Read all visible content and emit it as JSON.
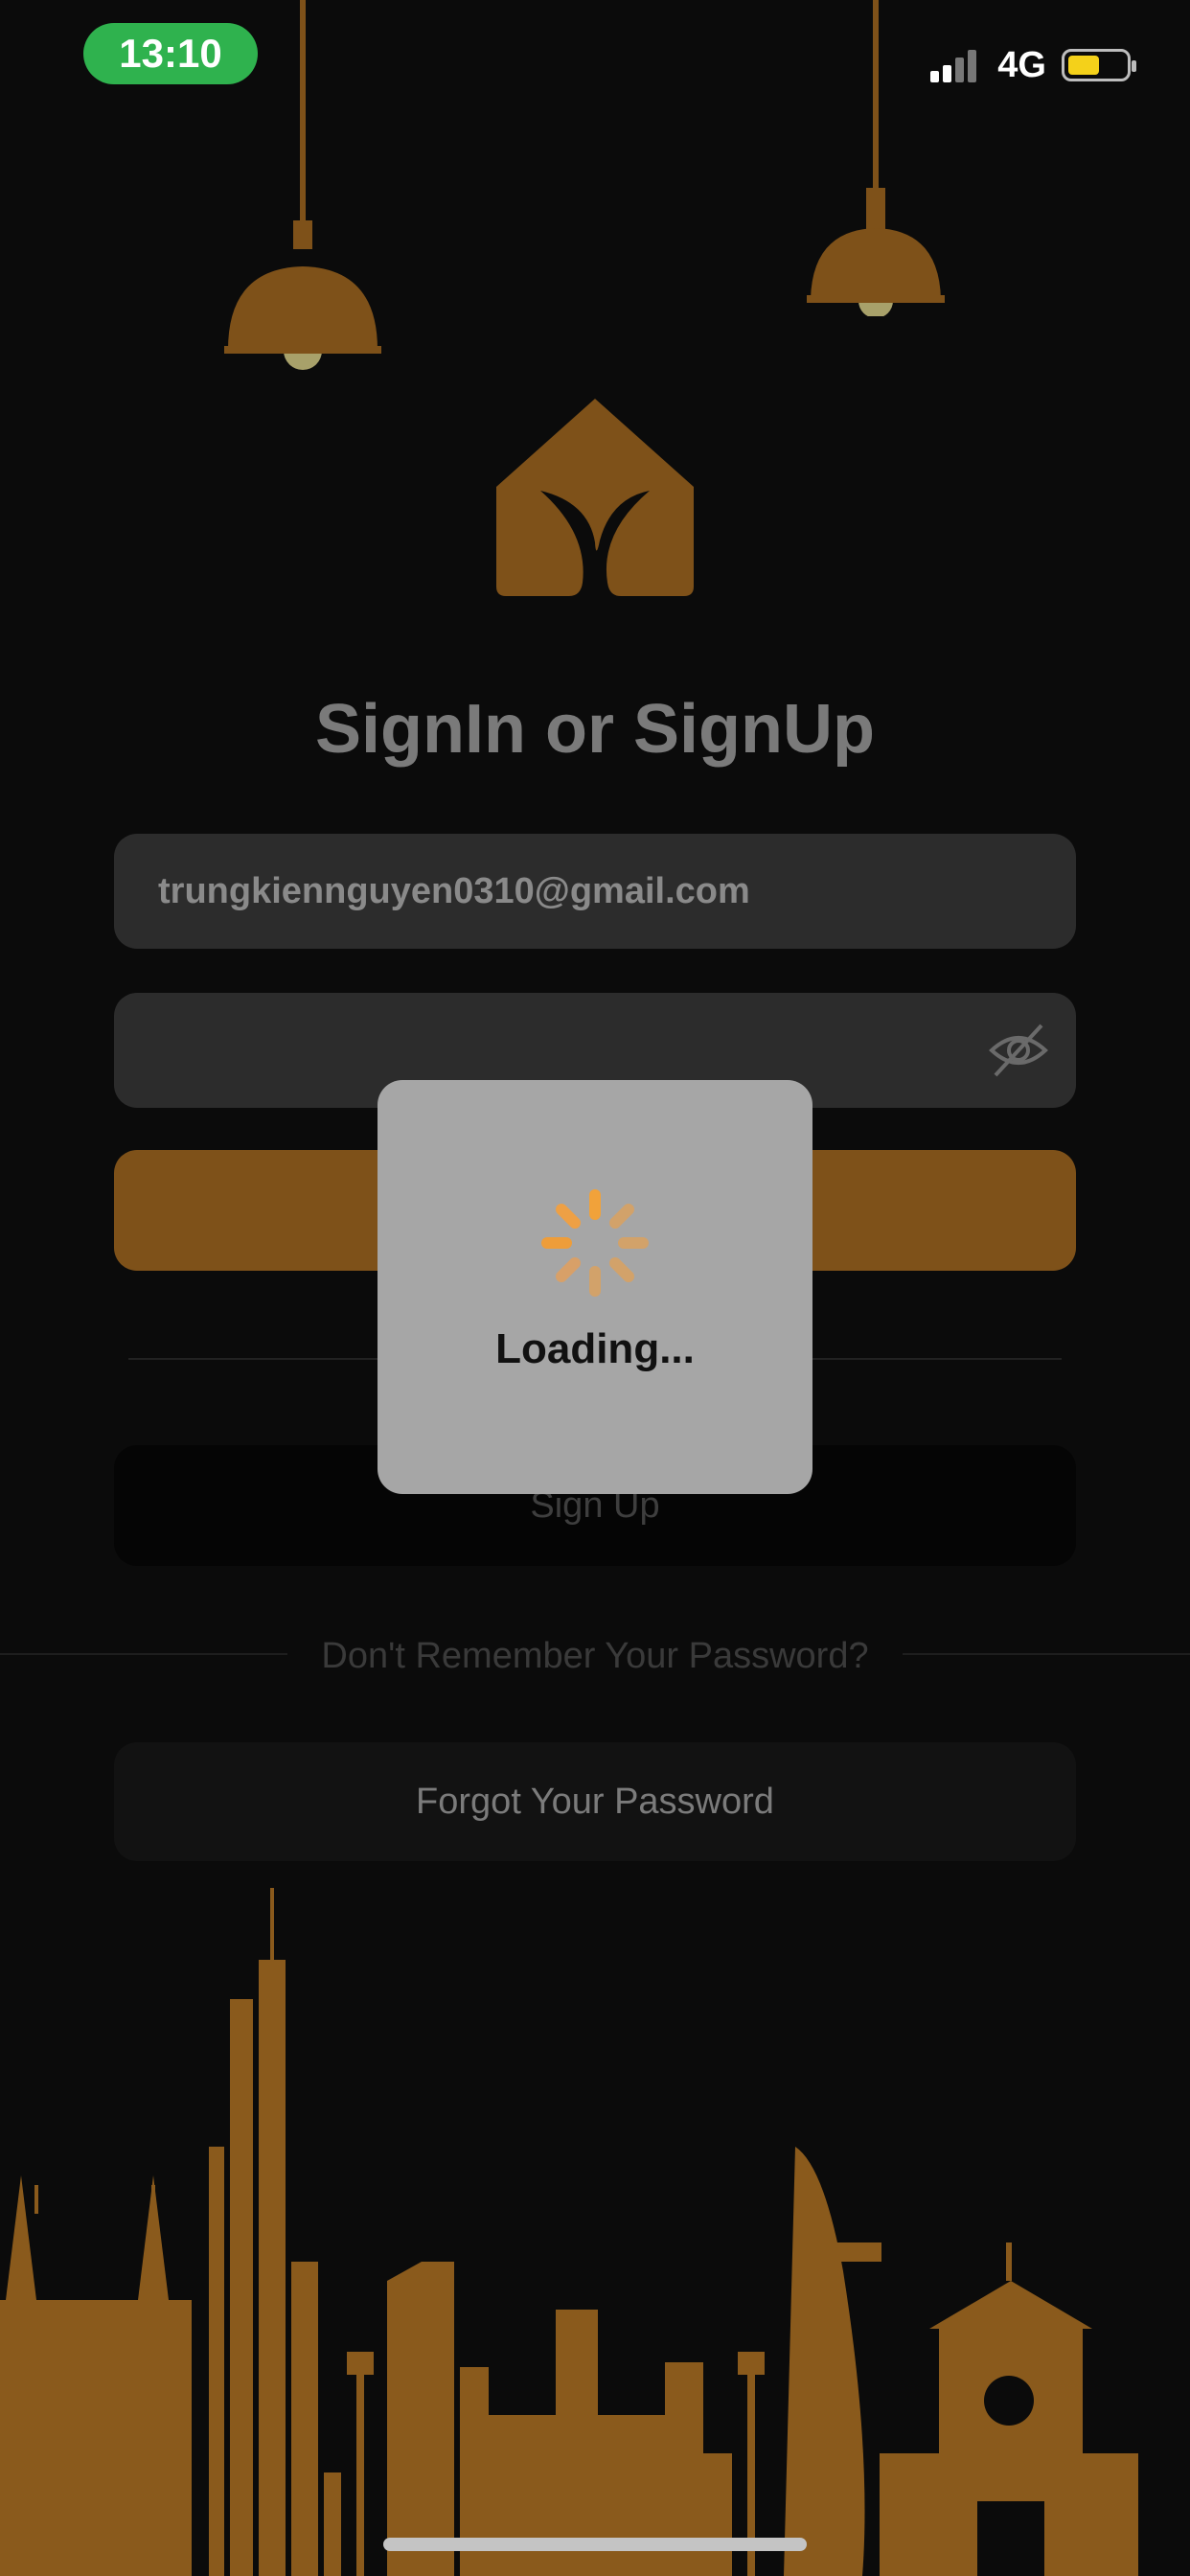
{
  "status_bar": {
    "time": "13:10",
    "network": "4G",
    "battery_color": "#f4d11a",
    "time_pill_color": "#2fb24e"
  },
  "auth": {
    "title": "SignIn or SignUp",
    "email_value": "trungkiennguyen0310@gmail.com",
    "password_value": "",
    "signup_label": "Sign Up",
    "forgot_prompt": "Don't Remember Your Password?",
    "forgot_button": "Forgot Your Password"
  },
  "loading": {
    "text": "Loading..."
  },
  "colors": {
    "accent": "#7e5119",
    "background": "#0b0b0b",
    "field": "#2c2c2c"
  },
  "icons": {
    "logo": "house-leaf-logo",
    "password_toggle": "eye-off-icon",
    "spinner": "spinner-icon"
  }
}
